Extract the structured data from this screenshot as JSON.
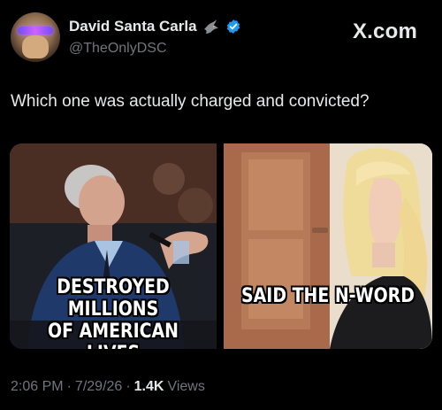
{
  "header": {
    "display_name": "David Santa Carla",
    "handle": "@TheOnlyDSC",
    "brand": "X.com"
  },
  "tweet": {
    "text": "Which one was actually charged and convicted?"
  },
  "media": {
    "left_caption_line1": "DESTROYED MILLIONS",
    "left_caption_line2": "OF AMERICAN LIVES",
    "right_caption": "SAID THE N-WORD"
  },
  "meta": {
    "time": "2:06 PM",
    "sep1": "·",
    "date": "7/29/26",
    "sep2": "·",
    "views_count": "1.4K",
    "views_label": "Views"
  },
  "colors": {
    "background": "#000000",
    "text": "#e7e9ea",
    "secondary": "#71767b",
    "verified": "#1d9bf0"
  }
}
